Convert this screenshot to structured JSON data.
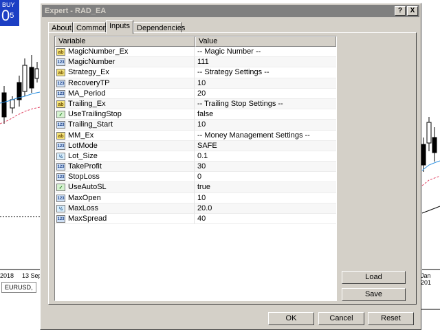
{
  "chart": {
    "buy_label": "BUY",
    "price_big": "0",
    "price_sup": "5",
    "axis_labels": [
      "2018",
      "13 Sep",
      "Jan 201"
    ],
    "symbol_tab": "EURUSD,"
  },
  "dialog": {
    "title": "Expert - RAD_EA",
    "help_btn": "?",
    "close_btn": "X",
    "tabs": [
      {
        "label": "About"
      },
      {
        "label": "Common"
      },
      {
        "label": "Inputs"
      },
      {
        "label": "Dependencies"
      }
    ],
    "active_tab": "Inputs",
    "columns": {
      "variable": "Variable",
      "value": "Value"
    },
    "inputs": [
      {
        "name": "MagicNumber_Ex",
        "value": "-- Magic Number --",
        "type": "ab"
      },
      {
        "name": "MagicNumber",
        "value": "111",
        "type": "num"
      },
      {
        "name": "Strategy_Ex",
        "value": "-- Strategy Settings --",
        "type": "ab"
      },
      {
        "name": "RecoveryTP",
        "value": "10",
        "type": "num"
      },
      {
        "name": "MA_Period",
        "value": "20",
        "type": "num"
      },
      {
        "name": "Trailing_Ex",
        "value": "-- Trailing Stop Settings --",
        "type": "ab"
      },
      {
        "name": "UseTrailingStop",
        "value": "false",
        "type": "bool"
      },
      {
        "name": "Trailing_Start",
        "value": "10",
        "type": "num"
      },
      {
        "name": "MM_Ex",
        "value": "-- Money Management Settings --",
        "type": "ab"
      },
      {
        "name": "LotMode",
        "value": "SAFE",
        "type": "num"
      },
      {
        "name": "Lot_Size",
        "value": "0.1",
        "type": "dbl"
      },
      {
        "name": "TakeProfit",
        "value": "30",
        "type": "num"
      },
      {
        "name": "StopLoss",
        "value": "0",
        "type": "num"
      },
      {
        "name": "UseAutoSL",
        "value": "true",
        "type": "bool"
      },
      {
        "name": "MaxOpen",
        "value": "10",
        "type": "num"
      },
      {
        "name": "MaxLoss",
        "value": "20.0",
        "type": "dbl"
      },
      {
        "name": "MaxSpread",
        "value": "40",
        "type": "num"
      }
    ],
    "type_icons": {
      "ab": "ab",
      "num": "123",
      "dbl": "½",
      "bool": "✓"
    },
    "load_label": "Load",
    "save_label": "Save",
    "ok_label": "OK",
    "cancel_label": "Cancel",
    "reset_label": "Reset"
  }
}
